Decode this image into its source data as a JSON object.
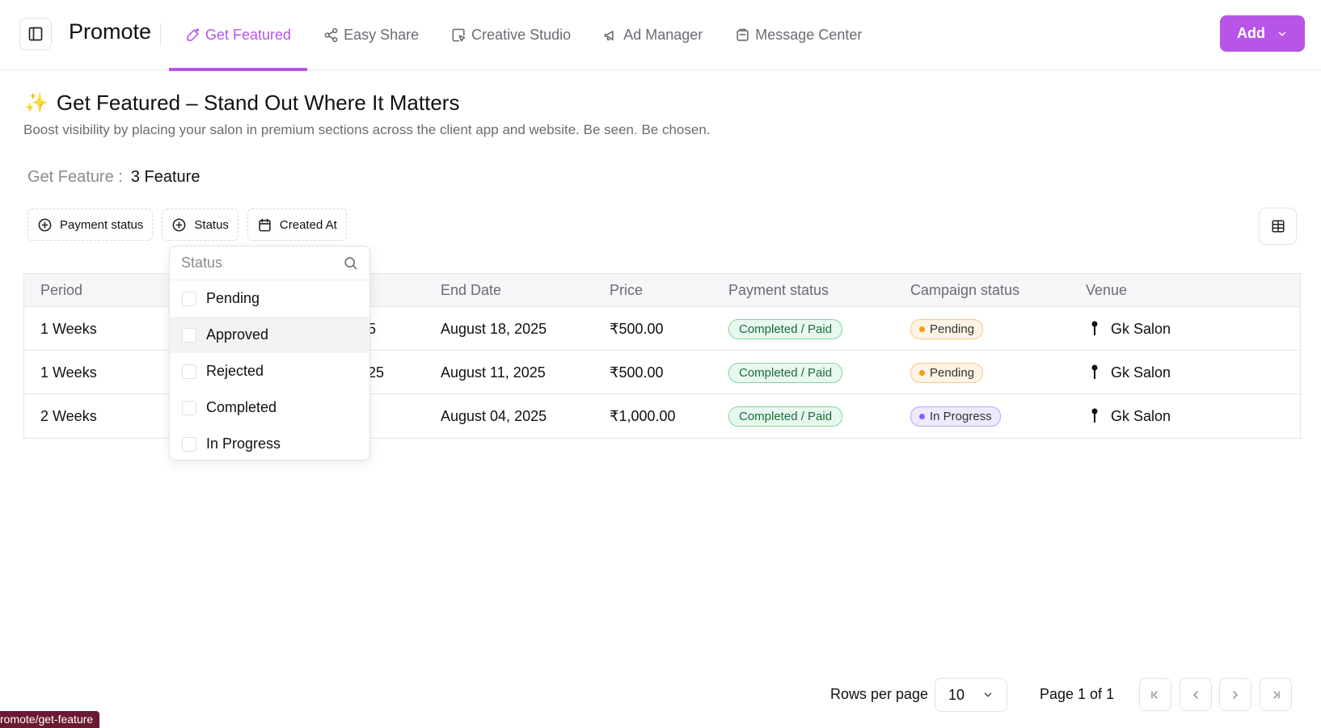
{
  "header": {
    "app_title": "Promote",
    "tabs": [
      {
        "label": "Get Featured",
        "icon": "sparkle-pen-icon",
        "active": true
      },
      {
        "label": "Easy Share",
        "icon": "share-icon",
        "active": false
      },
      {
        "label": "Creative Studio",
        "icon": "creative-studio-icon",
        "active": false
      },
      {
        "label": "Ad Manager",
        "icon": "megaphone-icon",
        "active": false
      },
      {
        "label": "Message Center",
        "icon": "message-box-icon",
        "active": false
      }
    ],
    "add_button": "Add",
    "accent_color": "#b655e8"
  },
  "intro": {
    "emoji": "✨",
    "title": "Get Featured – Stand Out Where It Matters",
    "subtitle": "Boost visibility by placing your salon in premium sections across the client app and website. Be seen. Be chosen."
  },
  "summary": {
    "label": "Get Feature :",
    "value": "3 Feature"
  },
  "filters": {
    "payment_status": "Payment status",
    "status": "Status",
    "created_at": "Created At"
  },
  "table": {
    "headers": {
      "period": "Period",
      "end_date": "End Date",
      "price": "Price",
      "payment_status": "Payment status",
      "campaign_status": "Campaign status",
      "venue": "Venue"
    },
    "rows": [
      {
        "period": "1 Weeks",
        "start_fragment": "5",
        "end_date": "August 18, 2025",
        "price": "₹500.00",
        "payment_status": "Completed / Paid",
        "campaign_status": "Pending",
        "venue": "Gk Salon"
      },
      {
        "period": "1 Weeks",
        "start_fragment": "25",
        "end_date": "August 11, 2025",
        "price": "₹500.00",
        "payment_status": "Completed / Paid",
        "campaign_status": "Pending",
        "venue": "Gk Salon"
      },
      {
        "period": "2 Weeks",
        "start_fragment": "",
        "end_date": "August 04, 2025",
        "price": "₹1,000.00",
        "payment_status": "Completed / Paid",
        "campaign_status": "In Progress",
        "venue": "Gk Salon"
      }
    ]
  },
  "status_dropdown": {
    "placeholder": "Status",
    "options": [
      "Pending",
      "Approved",
      "Rejected",
      "Completed",
      "In Progress"
    ]
  },
  "pagination": {
    "rows_per_page_label": "Rows per page",
    "rows_per_page_value": "10",
    "page_info": "Page 1 of 1"
  },
  "status_bar": {
    "url": "romote/get-feature"
  },
  "colors": {
    "paid": "#1a6b3c",
    "pending_dot": "#f59e0b",
    "progress_dot": "#8b5cf6"
  }
}
